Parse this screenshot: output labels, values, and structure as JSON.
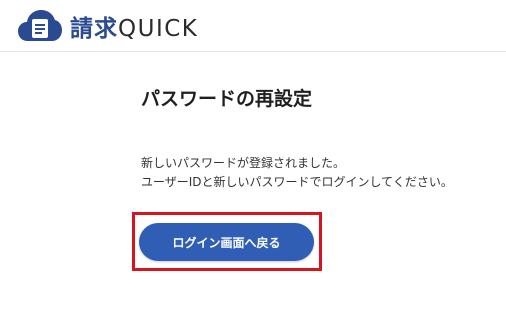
{
  "header": {
    "brand_name": "請求",
    "brand_suffix": "QUICK",
    "logo_icon": "cloud-document-icon"
  },
  "main": {
    "title": "パスワードの再設定",
    "message_lines": [
      "新しいパスワードが登録されました。",
      "ユーザーIDと新しいパスワードでログインしてください。"
    ],
    "login_button_label": "ログイン画面へ戻る"
  },
  "colors": {
    "brand": "#2a4a92",
    "button": "#2f5eb4",
    "highlight": "#d8141d"
  }
}
